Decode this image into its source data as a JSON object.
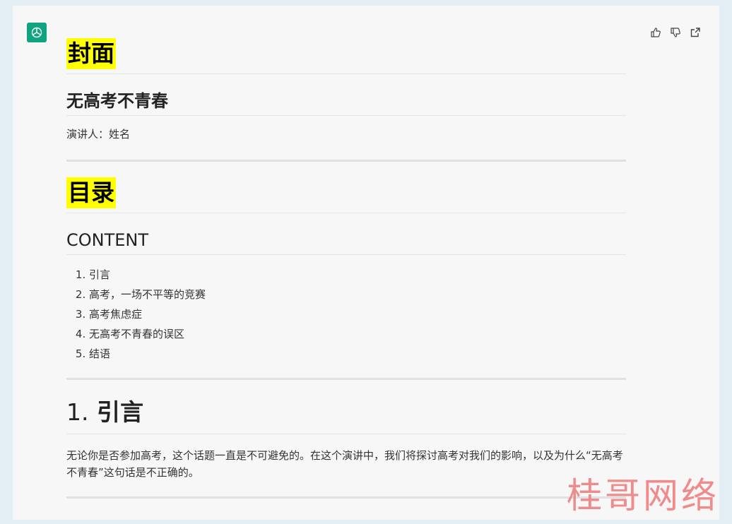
{
  "cover": {
    "heading": "封面",
    "title": "无高考不青春",
    "speaker": "演讲人：姓名"
  },
  "toc": {
    "heading": "目录",
    "subtitle": "CONTENT",
    "items": [
      "引言",
      "高考，一场不平等的竞赛",
      "高考焦虑症",
      "无高考不青春的误区",
      "结语"
    ]
  },
  "section1": {
    "number": "1.",
    "title": "引言",
    "body": "无论你是否参加高考，这个话题一直是不可避免的。在这个演讲中，我们将探讨高考对我们的影响，以及为什么“无高考不青春”这句话是不正确的。"
  },
  "actions": [
    "thumbs-up-icon",
    "thumbs-down-icon",
    "share-icon"
  ],
  "watermark": "桂哥网络",
  "colors": {
    "highlight": "#ffff00",
    "avatar": "#10a37f",
    "watermark": "#f08080"
  }
}
